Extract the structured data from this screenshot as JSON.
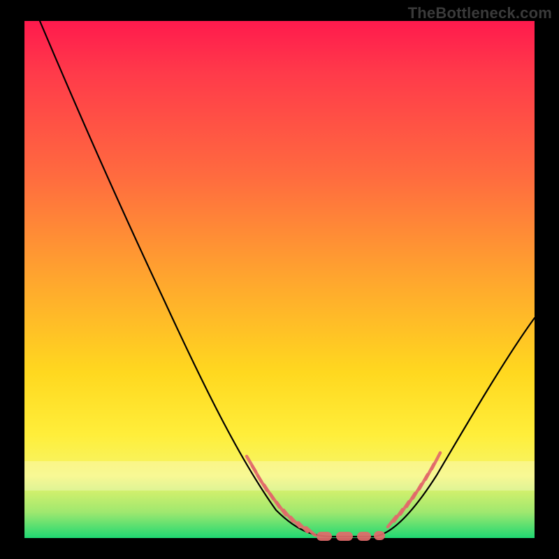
{
  "watermark": "TheBottleneck.com",
  "colors": {
    "page_bg": "#000000",
    "gradient_top": "#ff1a4d",
    "gradient_mid": "#ffd81f",
    "gradient_bottom": "#1fd872",
    "curve": "#000000",
    "marker": "#e26a6a"
  },
  "chart_data": {
    "type": "line",
    "title": "",
    "xlabel": "",
    "ylabel": "",
    "xlim": [
      0,
      100
    ],
    "ylim": [
      0,
      100
    ],
    "x": [
      3,
      10,
      20,
      30,
      40,
      45,
      50,
      55,
      58,
      61,
      64,
      68,
      72,
      78,
      84,
      90,
      96,
      100
    ],
    "values": [
      100,
      87,
      68,
      49,
      30,
      21,
      12,
      5,
      2,
      0,
      0,
      0,
      2,
      7,
      15,
      25,
      35,
      42
    ],
    "marker_ranges_x": [
      [
        41,
        58
      ],
      [
        69,
        80
      ]
    ],
    "bottom_pill_x": [
      [
        58,
        69
      ]
    ],
    "notes": "V-shaped bottleneck curve over a heat-gradient background. y=0 corresponds to optimal (green band at bottom). Salmon markers highlight near-optimal regions on both descending and ascending legs and a flat bottom segment."
  }
}
